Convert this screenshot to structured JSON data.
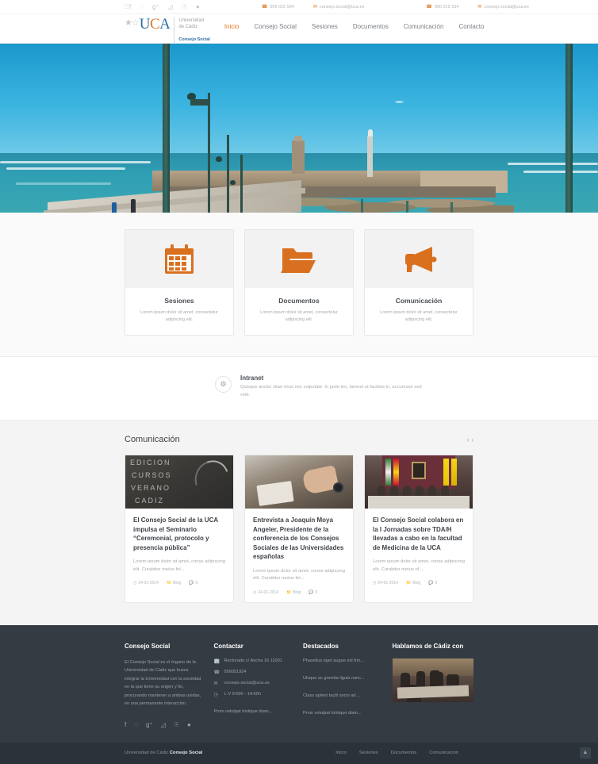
{
  "topbar": {
    "social_icons": [
      "facebook-icon",
      "twitter-icon",
      "google-plus-icon",
      "rss-icon",
      "pinterest-icon",
      "dribbble-icon"
    ],
    "contacts": [
      {
        "phone": "956 015 934",
        "email": "consejo.social@uca.es"
      },
      {
        "phone": "956 015 934",
        "email": "consejo.social@uca.es"
      }
    ]
  },
  "header": {
    "logo": {
      "mark": "UCA",
      "letters": [
        "U",
        "C",
        "A"
      ],
      "university": "Universidad\nde Cádiz",
      "university_line1": "Universidad",
      "university_line2": "de Cádiz",
      "subtitle": "Consejo Social"
    },
    "nav": [
      {
        "label": "Inicio",
        "active": true
      },
      {
        "label": "Consejo Social",
        "active": false
      },
      {
        "label": "Sesiones",
        "active": false
      },
      {
        "label": "Documentos",
        "active": false
      },
      {
        "label": "Comunicación",
        "active": false
      },
      {
        "label": "Contacto",
        "active": false
      }
    ]
  },
  "hero": {
    "alt": "Paseo Fernando Quiñones hacia el Castillo de San Sebastián, Cádiz"
  },
  "features": [
    {
      "icon": "calendar-icon",
      "title": "Sesiones",
      "desc": "Lorem ipsum dolor sit amet, consectetur adipiscing elit."
    },
    {
      "icon": "folder-icon",
      "title": "Documentos",
      "desc": "Lorem ipsum dolor sit amet, consectetur adipiscing elit."
    },
    {
      "icon": "megaphone-icon",
      "title": "Comunicación",
      "desc": "Lorem ipsum dolor sit amet, consectetur adipiscing elit."
    }
  ],
  "intranet": {
    "icon": "gears-icon",
    "title": "Intranet",
    "desc": "Quisque auctor vitae risus nec vulputate. In justo leo, laoreet ut facilisis in, accumsan sed velit."
  },
  "blog": {
    "title": "Comunicación",
    "prev_label": "‹",
    "next_label": "›",
    "posts": [
      {
        "image": "chalkboard-edicion-cursos-verano-cadiz",
        "image_text_lines": [
          "EDICION",
          "CURSOS",
          "VERANO",
          "CADIZ"
        ],
        "title": "El Consejo Social de la UCA impulsa el Seminario “Ceremonial, protocolo y presencia pública”",
        "excerpt": "Lorem ipsum dolor sit amet, conse adipiscing elit. Curabitur metus fel...",
        "date": "24-01-2014",
        "category": "Blog",
        "comments": "0"
      },
      {
        "image": "hands-writing-on-desk",
        "title": "Entrevista a Joaquín Moya Angeler, Presidente de la conferencia de los Consejos Sociales de las Universidades españolas",
        "excerpt": "Lorem ipsum dolor sit amet, conse adipiscing elit. Curabitur metus fel...",
        "date": "24-01-2014",
        "category": "Blog",
        "comments": "0"
      },
      {
        "image": "conference-panel-jornada-tdah",
        "title": "El Consejo Social colabora en la I Jornadas sobre TDA/H llevadas a cabo en la facultad de Medicina de la UCA",
        "excerpt": "Lorem ipsum dolor sit amet, conse adipiscing elit. Curabitur metus of ...",
        "date": "24-01-2014",
        "category": "Blog",
        "comments": "0"
      }
    ]
  },
  "footer": {
    "about": {
      "title": "Consejo Social",
      "text": "El Consejo Social es el órgano de la Universidad de Cádiz que busca integrar la Universidad con la sociedad en la que tiene su origen y fin, procurando mantener a ambas unidas, en una permanente interacción.",
      "social_icons": [
        "facebook-icon",
        "twitter-icon",
        "google-plus-icon",
        "rss-icon",
        "pinterest-icon",
        "dribbble-icon"
      ]
    },
    "contact": {
      "title": "Contactar",
      "items": [
        {
          "icon": "building-icon",
          "text": "Rectorado c/ Ancha 16 11001"
        },
        {
          "icon": "phone-icon",
          "text": "956051934"
        },
        {
          "icon": "envelope-icon",
          "text": "consejo.social@uca.es"
        },
        {
          "icon": "clock-icon",
          "text": "L-V 9:00h - 14:00h"
        }
      ],
      "note": "Proin volutpat tristique diam..."
    },
    "featured": {
      "title": "Destacados",
      "items": [
        "Phasellus eget augue est frin...",
        "Ulsque ac gravida ligula nunc...",
        "Class aptent taciti socio ad ...",
        "Proin volutpat tristique diam..."
      ]
    },
    "gallery": {
      "title": "Hablamos de Cádiz con",
      "image": "conference-room-photo"
    }
  },
  "bottombar": {
    "copy_prefix": "Universidad de Cádiz ",
    "copy_strong": "Consejo Social",
    "links": [
      "Inicio",
      "Sesiones",
      "Documentos",
      "Comunicación"
    ],
    "back_to_top": "▲"
  },
  "colors": {
    "accent": "#e07b27",
    "blue": "#2f6ca5",
    "footer_bg": "#343b43",
    "bottom_bg": "#2c323a"
  }
}
